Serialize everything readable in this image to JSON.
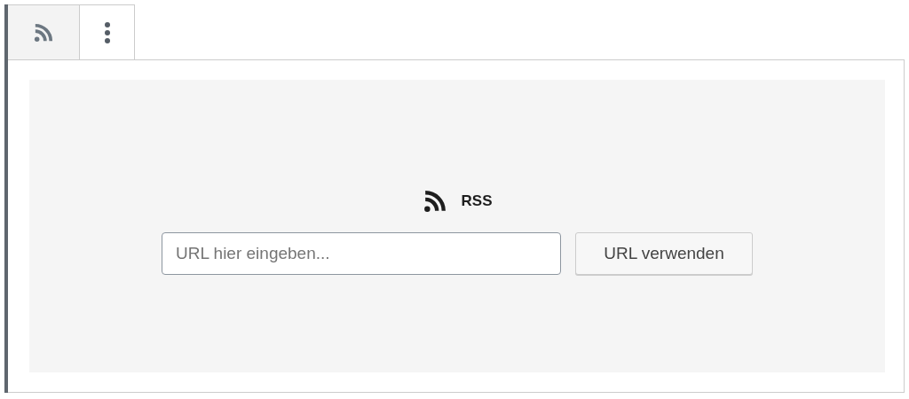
{
  "toolbar": [
    {
      "kind": "rss",
      "selected": true
    },
    {
      "kind": "more",
      "selected": false
    }
  ],
  "placeholder_block": {
    "label": "RSS",
    "input": {
      "placeholder": "URL hier eingeben..."
    },
    "button": "URL verwenden"
  }
}
